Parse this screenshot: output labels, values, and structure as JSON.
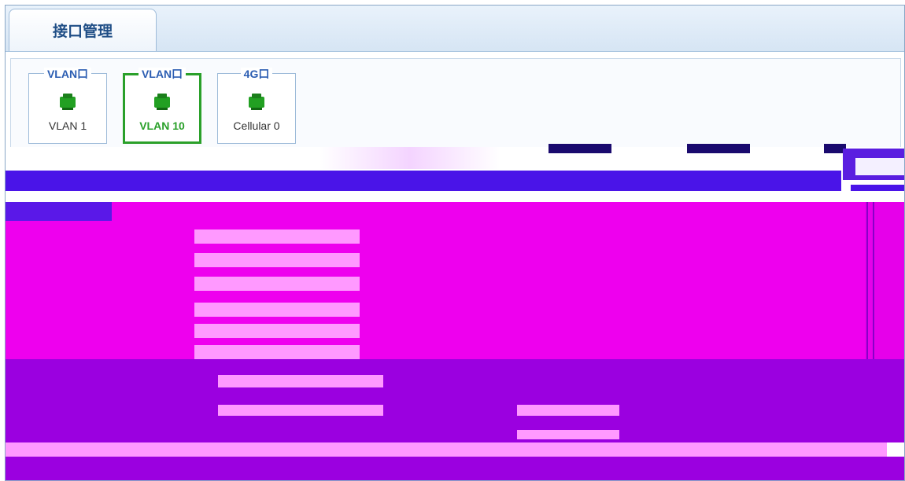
{
  "tab": {
    "label": "接口管理"
  },
  "ports": [
    {
      "group": "VLAN口",
      "name": "VLAN 1",
      "selected": false
    },
    {
      "group": "VLAN口",
      "name": "VLAN 10",
      "selected": true
    },
    {
      "group": "4G口",
      "name": "Cellular 0",
      "selected": false
    }
  ],
  "colors": {
    "port_icon": "#22a022",
    "selected_border": "#2aa02a",
    "tab_text": "#1f4e86",
    "legend_text": "#2b5db2",
    "glitch_magenta": "#ee00ee",
    "glitch_purple": "#9b00e0",
    "glitch_blue": "#4a14e8"
  },
  "icons": {
    "port": "ethernet-port-icon"
  }
}
